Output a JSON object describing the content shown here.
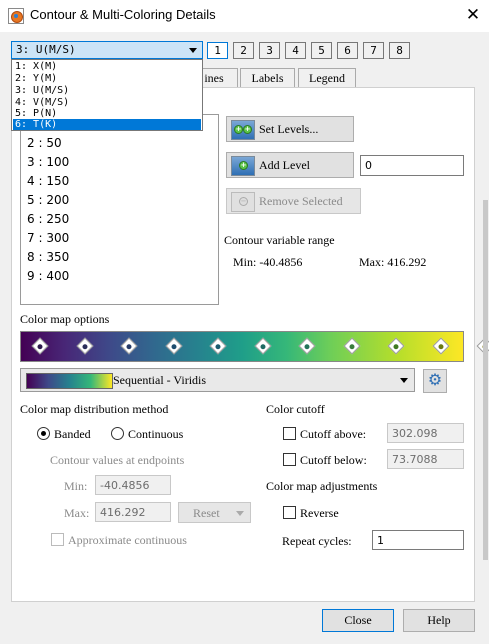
{
  "window": {
    "title": "Contour & Multi-Coloring Details",
    "close_glyph": "✕"
  },
  "variable_selector": {
    "selected": "3: U(M/S)",
    "options": [
      "1: X(M)",
      "2: Y(M)",
      "3: U(M/S)",
      "4: V(M/S)",
      "5: P(N)",
      "6: T(K)"
    ],
    "highlighted": "6: T(K)"
  },
  "group_tabs": [
    "1",
    "2",
    "3",
    "4",
    "5",
    "6",
    "7",
    "8"
  ],
  "tabs": {
    "lines_partial": "ines",
    "labels": "Labels",
    "legend": "Legend"
  },
  "levels": [
    {
      "index": "2",
      "value": "50"
    },
    {
      "index": "3",
      "value": "100"
    },
    {
      "index": "4",
      "value": "150"
    },
    {
      "index": "5",
      "value": "200"
    },
    {
      "index": "6",
      "value": "250"
    },
    {
      "index": "7",
      "value": "300"
    },
    {
      "index": "8",
      "value": "350"
    },
    {
      "index": "9",
      "value": "400"
    }
  ],
  "buttons": {
    "set_levels": "Set Levels...",
    "add_level": "Add Level",
    "remove_selected": "Remove Selected",
    "reset": "Reset",
    "close": "Close",
    "help": "Help"
  },
  "add_level_value": "0",
  "contour_range": {
    "heading": "Contour variable range",
    "min_label": "Min:",
    "min": "-40.4856",
    "max_label": "Max:",
    "max": "416.292"
  },
  "color_map": {
    "options_heading": "Color map options",
    "selected": "Sequential - Viridis",
    "control_points": 11
  },
  "distribution": {
    "heading": "Color map distribution method",
    "banded": "Banded",
    "continuous": "Continuous",
    "mode": "banded",
    "endpoints_heading": "Contour values at endpoints",
    "min_label": "Min:",
    "min": "-40.4856",
    "max_label": "Max:",
    "max": "416.292",
    "approx": "Approximate continuous"
  },
  "cutoff": {
    "heading": "Color cutoff",
    "above_label": "Cutoff above:",
    "above_value": "302.098",
    "below_label": "Cutoff below:",
    "below_value": "73.7088"
  },
  "adjustments": {
    "heading": "Color map adjustments",
    "reverse": "Reverse",
    "repeat_label": "Repeat cycles:",
    "repeat_value": "1"
  },
  "colors": {
    "accent": "#0078d7",
    "selection_bg": "#cce4f7"
  }
}
